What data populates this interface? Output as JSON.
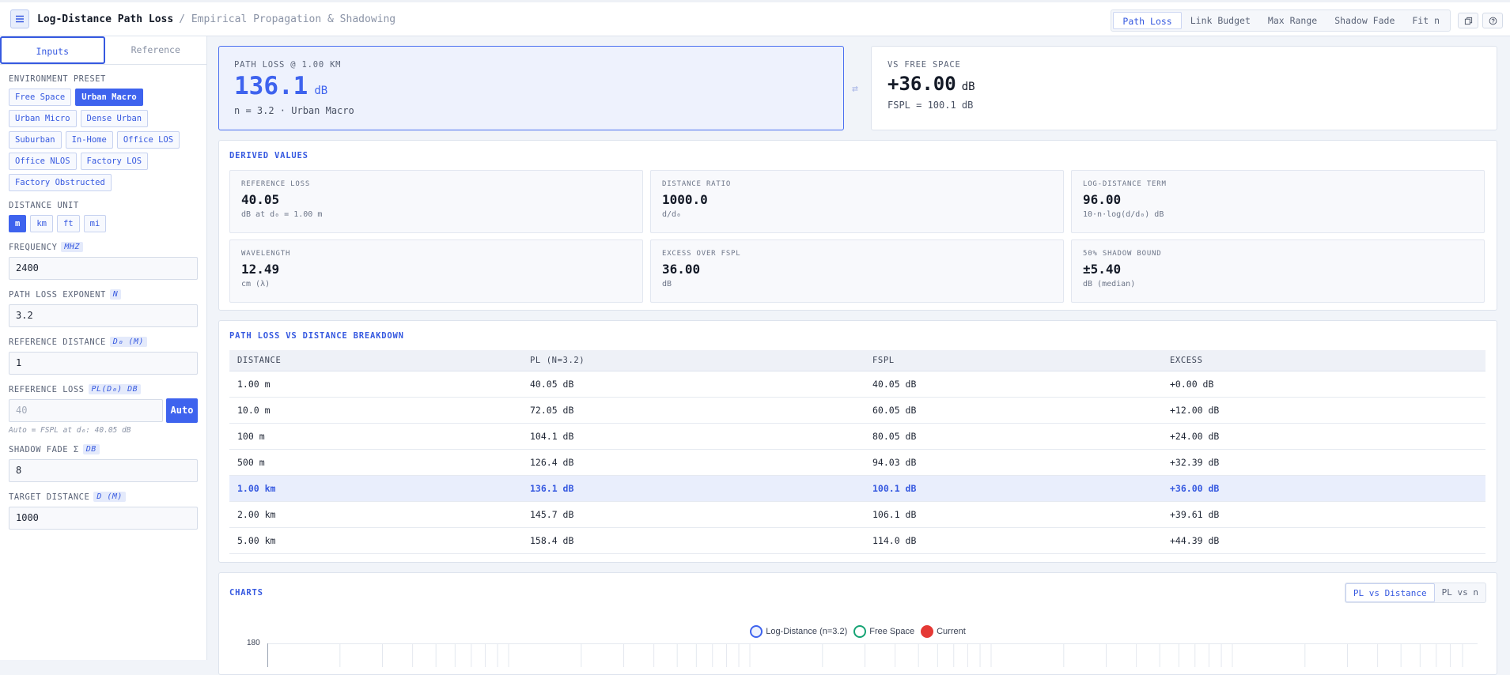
{
  "header": {
    "title": "Log-Distance Path Loss",
    "subtitle": "/ Empirical Propagation & Shadowing",
    "nav": [
      "Path Loss",
      "Link Budget",
      "Max Range",
      "Shadow Fade",
      "Fit n"
    ]
  },
  "sidebar": {
    "tabs": [
      "Inputs",
      "Reference"
    ],
    "env_label": "ENVIRONMENT PRESET",
    "presets": [
      "Free Space",
      "Urban Macro",
      "Urban Micro",
      "Dense Urban",
      "Suburban",
      "In-Home",
      "Office LOS",
      "Office NLOS",
      "Factory LOS",
      "Factory Obstructed"
    ],
    "unit_label": "DISTANCE UNIT",
    "units": [
      "m",
      "km",
      "ft",
      "mi"
    ],
    "freq_label": "FREQUENCY",
    "freq_tag": "MHZ",
    "freq_value": "2400",
    "n_label": "PATH LOSS EXPONENT",
    "n_tag": "N",
    "n_value": "3.2",
    "d0_label": "REFERENCE DISTANCE",
    "d0_tag": "D₀ (M)",
    "d0_value": "1",
    "pl0_label": "REFERENCE LOSS",
    "pl0_tag": "PL(D₀) DB",
    "pl0_placeholder": "40",
    "auto_label": "Auto",
    "pl0_hint": "Auto = FSPL at d₀: 40.05 dB",
    "sigma_label": "SHADOW FADE Σ",
    "sigma_tag": "DB",
    "sigma_value": "8",
    "d_label": "TARGET DISTANCE",
    "d_tag": "D (M)",
    "d_value": "1000"
  },
  "kpi": {
    "pl_label": "PATH LOSS @ 1.00 KM",
    "pl_value": "136.1",
    "pl_unit": "dB",
    "pl_sub": "n = 3.2 · Urban Macro",
    "swap_icon": "⇄",
    "fs_label": "VS FREE SPACE",
    "fs_value": "+36.00",
    "fs_unit": "dB",
    "fs_sub": "FSPL = 100.1 dB"
  },
  "derived": {
    "title": "DERIVED VALUES",
    "items": [
      {
        "label": "REFERENCE LOSS",
        "value": "40.05",
        "sub": "dB at d₀ = 1.00 m"
      },
      {
        "label": "DISTANCE RATIO",
        "value": "1000.0",
        "sub": "d/d₀"
      },
      {
        "label": "LOG-DISTANCE TERM",
        "value": "96.00",
        "sub": "10·n·log(d/d₀) dB"
      },
      {
        "label": "WAVELENGTH",
        "value": "12.49",
        "sub": "cm (λ)"
      },
      {
        "label": "EXCESS OVER FSPL",
        "value": "36.00",
        "sub": "dB"
      },
      {
        "label": "50% SHADOW BOUND",
        "value": "±5.40",
        "sub": "dB (median)"
      }
    ]
  },
  "table": {
    "title": "PATH LOSS VS DISTANCE BREAKDOWN",
    "headers": [
      "DISTANCE",
      "PL (N=3.2)",
      "FSPL",
      "EXCESS"
    ],
    "rows": [
      [
        "1.00 m",
        "40.05 dB",
        "40.05 dB",
        "+0.00 dB"
      ],
      [
        "10.0 m",
        "72.05 dB",
        "60.05 dB",
        "+12.00 dB"
      ],
      [
        "100 m",
        "104.1 dB",
        "80.05 dB",
        "+24.00 dB"
      ],
      [
        "500 m",
        "126.4 dB",
        "94.03 dB",
        "+32.39 dB"
      ],
      [
        "1.00 km",
        "136.1 dB",
        "100.1 dB",
        "+36.00 dB"
      ],
      [
        "2.00 km",
        "145.7 dB",
        "106.1 dB",
        "+39.61 dB"
      ],
      [
        "5.00 km",
        "158.4 dB",
        "114.0 dB",
        "+44.39 dB"
      ]
    ],
    "highlight_row": 4
  },
  "charts": {
    "title": "CHARTS",
    "tabs": [
      "PL vs Distance",
      "PL vs n"
    ],
    "legend": [
      {
        "label": "Log-Distance (n=3.2)",
        "color": "#3e63ee"
      },
      {
        "label": "Free Space",
        "color": "#16a374"
      },
      {
        "label": "Current",
        "color": "#e53935"
      }
    ],
    "y_tick_top": "180"
  },
  "colors": {
    "accent": "#3e63ee",
    "highlight": "#e9eefc"
  }
}
